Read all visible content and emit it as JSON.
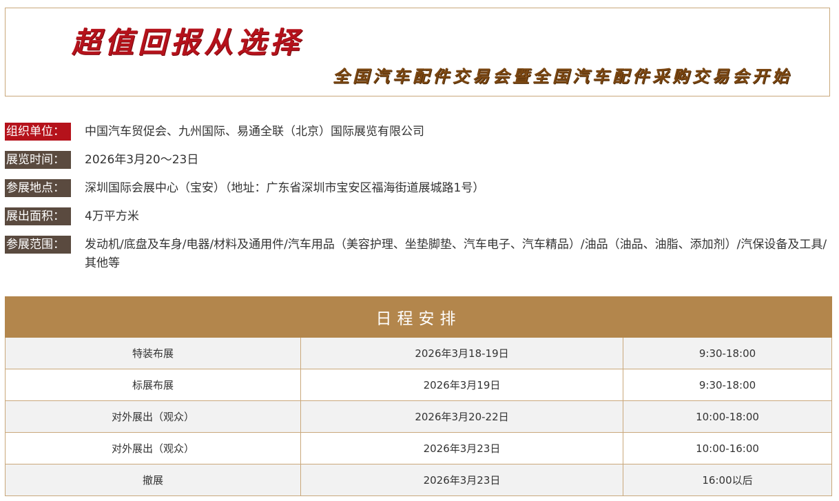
{
  "banner": {
    "title": "超值回报从选择",
    "subtitle": "全国汽车配件交易会暨全国汽车配件采购交易会开始"
  },
  "info": [
    {
      "label": "组织单位：",
      "value": "中国汽车贸促会、九州国际、易通全联（北京）国际展览有限公司",
      "label_style": "red"
    },
    {
      "label": "展览时间：",
      "value": "2026年3月20～23日",
      "label_style": "dark"
    },
    {
      "label": "参展地点：",
      "value": "深圳国际会展中心（宝安）（地址：广东省深圳市宝安区福海街道展城路1号）",
      "label_style": "dark"
    },
    {
      "label": "展出面积：",
      "value": "4万平方米",
      "label_style": "dark"
    },
    {
      "label": "参展范围：",
      "value": "发动机/底盘及车身/电器/材料及通用件/汽车用品（美容护理、坐垫脚垫、汽车电子、汽车精品）/油品（油品、油脂、添加剂）/汽保设备及工具/其他等",
      "label_style": "dark"
    }
  ],
  "schedule": {
    "header": "日程安排",
    "rows": [
      [
        "特装布展",
        "2026年3月18-19日",
        "9:30-18:00"
      ],
      [
        "标展布展",
        "2026年3月19日",
        "9:30-18:00"
      ],
      [
        "对外展出（观众）",
        "2026年3月20-22日",
        "10:00-18:00"
      ],
      [
        "对外展出（观众）",
        "2026年3月23日",
        "10:00-16:00"
      ],
      [
        "撤展",
        "2026年3月23日",
        "16:00以后"
      ]
    ]
  },
  "colors": {
    "accent_red": "#b5121b",
    "label_dark": "#5a4a3f",
    "header_gold": "#b3864c",
    "border_tan": "#c9a77a",
    "subtitle_brown": "#7b4712"
  }
}
